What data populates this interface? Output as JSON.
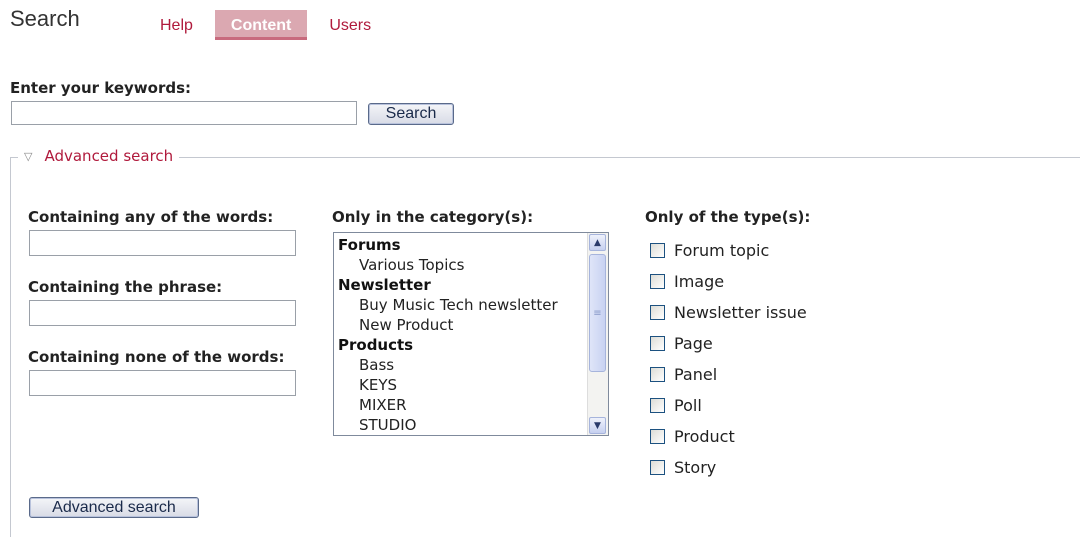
{
  "header": {
    "title": "Search",
    "tabs": [
      {
        "label": "Help",
        "active": false
      },
      {
        "label": "Content",
        "active": true
      },
      {
        "label": "Users",
        "active": false
      }
    ]
  },
  "keywords": {
    "label": "Enter your keywords:",
    "value": "",
    "button_label": "Search"
  },
  "advanced": {
    "legend": "Advanced search",
    "any_words": {
      "label": "Containing any of the words:",
      "value": ""
    },
    "phrase": {
      "label": "Containing the phrase:",
      "value": ""
    },
    "none_words": {
      "label": "Containing none of the words:",
      "value": ""
    },
    "category": {
      "label": "Only in the category(s):",
      "groups": [
        {
          "name": "Forums",
          "options": [
            "Various Topics"
          ]
        },
        {
          "name": "Newsletter",
          "options": [
            "Buy Music Tech newsletter",
            "New Product"
          ]
        },
        {
          "name": "Products",
          "options": [
            "Bass",
            "KEYS",
            "MIXER",
            "STUDIO"
          ]
        }
      ]
    },
    "type": {
      "label": "Only of the type(s):",
      "options": [
        "Forum topic",
        "Image",
        "Newsletter issue",
        "Page",
        "Panel",
        "Poll",
        "Product",
        "Story"
      ]
    },
    "button_label": "Advanced search"
  },
  "colors": {
    "accent": "#b01a3c",
    "active_tab_bg": "#dba8b1"
  },
  "icons": {
    "collapse": "triangle-down-icon",
    "scroll_up": "arrow-up-icon",
    "scroll_down": "arrow-down-icon"
  }
}
